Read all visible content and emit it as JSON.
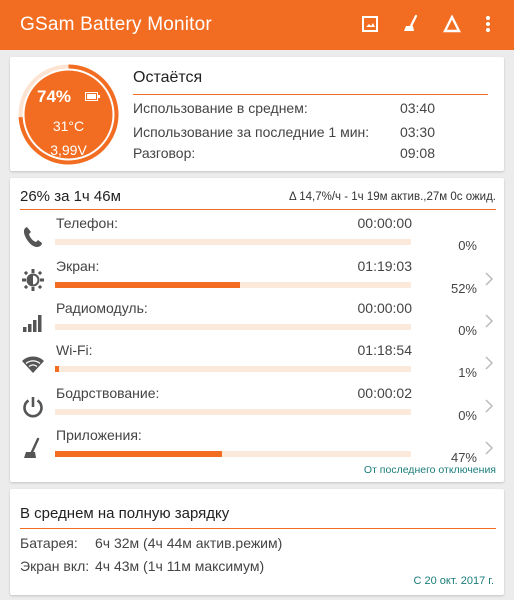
{
  "app": {
    "title": "GSam Battery Monitor",
    "accent": "#f26d21"
  },
  "toolbar": {
    "actions": [
      {
        "icon": "image-frame-icon"
      },
      {
        "icon": "broom-icon"
      },
      {
        "icon": "delta-icon"
      },
      {
        "icon": "more-vert-icon"
      }
    ]
  },
  "gauge": {
    "percent": "74%",
    "level": 0.74,
    "temperature": "31°C",
    "voltage": "3,99V"
  },
  "remaining": {
    "title": "Остаётся",
    "rows": [
      {
        "label": "Использование в среднем:",
        "value": "03:40"
      },
      {
        "label": "Использование за последние 1 мин:",
        "value": "03:30"
      },
      {
        "label": "Разговор:",
        "value": "09:08"
      }
    ]
  },
  "usage": {
    "summary_left": "26% за 1ч 46м",
    "summary_right": "Δ 14,7%/ч - 1ч 19м актив.,27м 0с ожид.",
    "rows": [
      {
        "label": "Телефон:",
        "time": "00:00:00",
        "percent": "0%",
        "fraction": 0.0,
        "icon": "phone-icon",
        "chevron": false
      },
      {
        "label": "Экран:",
        "time": "01:19:03",
        "percent": "52%",
        "fraction": 0.52,
        "icon": "brightness-icon",
        "chevron": true
      },
      {
        "label": "Радиомодуль:",
        "time": "00:00:00",
        "percent": "0%",
        "fraction": 0.0,
        "icon": "signal-bars-icon",
        "chevron": true
      },
      {
        "label": "Wi-Fi:",
        "time": "01:18:54",
        "percent": "1%",
        "fraction": 0.01,
        "icon": "wifi-icon",
        "chevron": true
      },
      {
        "label": "Бодрствование:",
        "time": "00:00:02",
        "percent": "0%",
        "fraction": 0.0,
        "icon": "power-icon",
        "chevron": true
      },
      {
        "label": "Приложения:",
        "time": "",
        "percent": "47%",
        "fraction": 0.47,
        "icon": "broom-icon",
        "chevron": true
      }
    ],
    "footer_link": "От последнего отключения"
  },
  "average": {
    "title": "В среднем на полную зарядку",
    "rows": [
      {
        "label": "Батарея:",
        "value": "6ч 32м (4ч 44м актив.режим)"
      },
      {
        "label": "Экран вкл:",
        "value": "4ч 43м (1ч 11м максимум)"
      }
    ],
    "since": "С 20 окт. 2017 г."
  }
}
